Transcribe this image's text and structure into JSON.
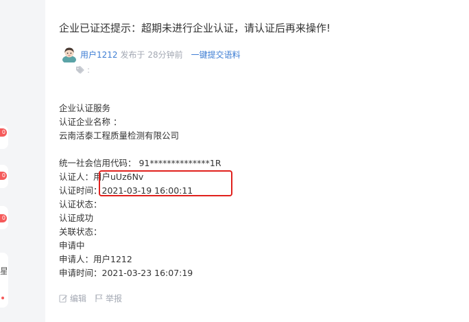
{
  "gutter": {
    "badges": [
      "0",
      "0",
      "0"
    ],
    "partial_glyph": "星"
  },
  "post": {
    "title": "企业已证还提示：超期未进行企业认证，请认证后再来操作!",
    "author": "用户1212",
    "posted_time": "发布于 28分钟前",
    "submit_link": "一键提交语料",
    "tag_sep": ":"
  },
  "content": {
    "lines_a": [
      "企业认证服务",
      "认证企业名称 ：",
      "云南活泰工程质量检测有限公司"
    ],
    "credit_code": "统一社会信用代码： 91**************1R",
    "certifier": "认证人：用户uUz6Nv",
    "cert_time": "认证时间：2021-03-19 16:00:11",
    "lines_b": [
      "认证状态：",
      "认证成功",
      "关联状态：",
      "申请中",
      "申请人：用户1212",
      "申请时间：2021-03-23 16:07:19"
    ]
  },
  "actions": {
    "edit": "编辑",
    "report": "举报"
  },
  "colors": {
    "link": "#3d7dd3",
    "muted": "#a3a8b3",
    "highlight": "#e0201c",
    "badge": "#f55a5a"
  }
}
